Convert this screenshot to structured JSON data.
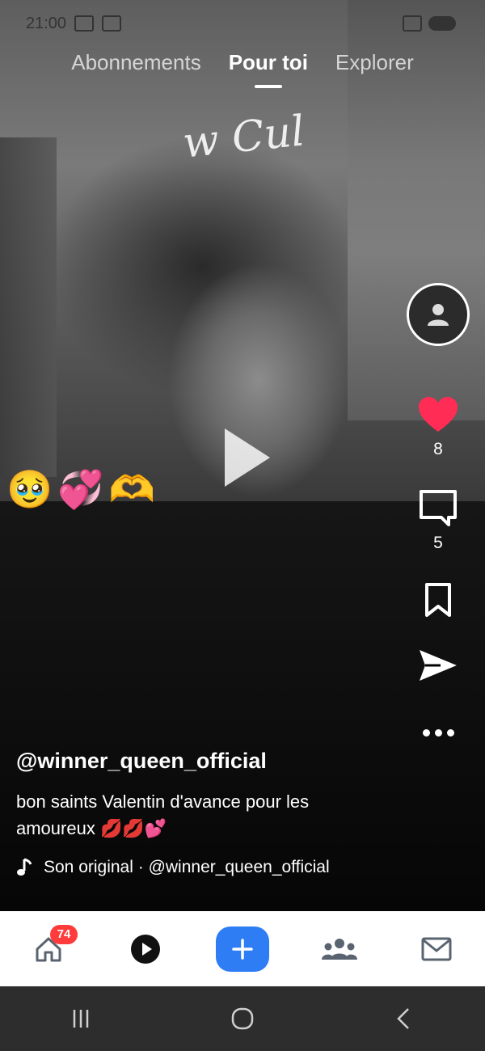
{
  "status_bar": {
    "time": "21:00"
  },
  "tabs": [
    {
      "label": "Abonnements"
    },
    {
      "label": "Pour toi",
      "active": true
    },
    {
      "label": "Explorer"
    }
  ],
  "video": {
    "watermark_text": "w Cul",
    "emoji_overlay": [
      "🥹",
      "💞",
      "🫶"
    ]
  },
  "actions": {
    "likes": "8",
    "comments": "5",
    "like_color": "#ff2d55"
  },
  "post": {
    "username": "@winner_queen_official",
    "caption": "bon saints Valentin d'avance pour les amoureux 💋💋💕",
    "sound": "Son original · @winner_queen_official"
  },
  "bottom_nav": {
    "home_badge": "74",
    "accent": "#2f7df4",
    "items": [
      "home-icon",
      "play-circle-icon",
      "add-icon",
      "community-icon",
      "mail-icon"
    ]
  }
}
